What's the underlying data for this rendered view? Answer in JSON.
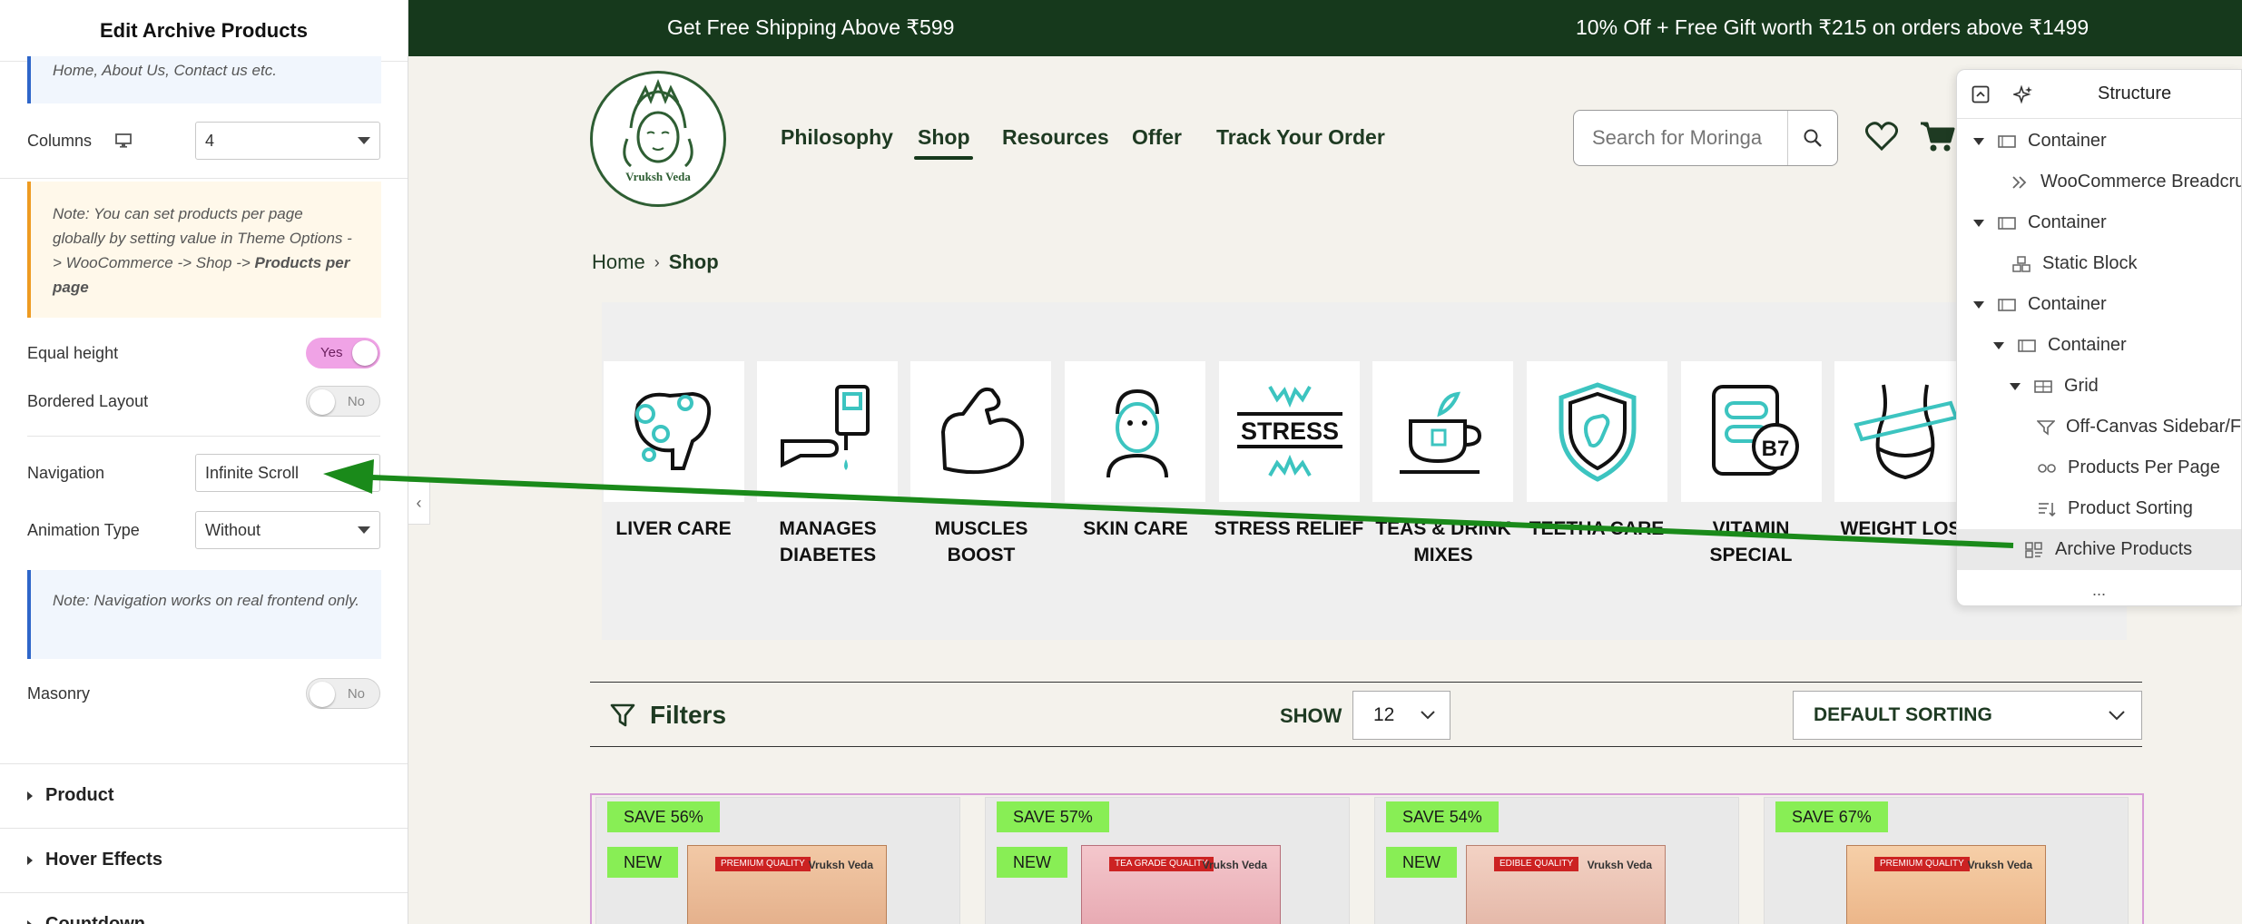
{
  "panel": {
    "title": "Edit Archive Products",
    "info_top": "Home, About Us, Contact us etc.",
    "columns_label": "Columns",
    "columns_value": "4",
    "note_text": "Note: You can set products per page globally by setting value in Theme Options -> WooCommerce -> Shop -> ",
    "note_bold": "Products per page",
    "equal_height_label": "Equal height",
    "equal_height_value": "Yes",
    "bordered_label": "Bordered Layout",
    "bordered_value": "No",
    "navigation_label": "Navigation",
    "navigation_value": "Infinite Scroll",
    "animation_label": "Animation Type",
    "animation_value": "Without",
    "nav_note": "Note: Navigation works on real frontend only.",
    "masonry_label": "Masonry",
    "masonry_value": "No",
    "sections": [
      "Product",
      "Hover Effects",
      "Countdown"
    ]
  },
  "topbar": {
    "left": "Get Free Shipping Above ₹599",
    "right": "10% Off + Free Gift worth ₹215 on orders above ₹1499"
  },
  "header": {
    "logo_text": "Vruksh Veda",
    "nav": [
      "Philosophy",
      "Shop",
      "Resources",
      "Offer",
      "Track Your Order"
    ],
    "search_placeholder": "Search for Moringa"
  },
  "breadcrumb": {
    "home": "Home",
    "current": "Shop"
  },
  "categories": [
    "LIVER CARE",
    "MANAGES DIABETES",
    "MUSCLES BOOST",
    "SKIN CARE",
    "STRESS RELIEF",
    "TEAS & DRINK MIXES",
    "TEETHA CARE",
    "VITAMIN SPECIAL",
    "WEIGHT LOS"
  ],
  "stress_icon_text": "STRESS",
  "vitamin_icon_text": "B7",
  "filters": {
    "label": "Filters",
    "show_label": "SHOW",
    "show_value": "12",
    "sort_value": "DEFAULT SORTING"
  },
  "products": [
    {
      "save": "SAVE 56%",
      "new": "NEW",
      "ribbon": "PREMIUM QUALITY",
      "brand": "Vruksh Veda"
    },
    {
      "save": "SAVE 57%",
      "new": "NEW",
      "ribbon": "TEA GRADE QUALITY",
      "brand": "Vruksh Veda"
    },
    {
      "save": "SAVE 54%",
      "new": "NEW",
      "ribbon": "EDIBLE QUALITY",
      "brand": "Vruksh Veda"
    },
    {
      "save": "SAVE 67%",
      "new": "",
      "ribbon": "PREMIUM QUALITY",
      "brand": "Vruksh Veda"
    }
  ],
  "structure": {
    "title": "Structure",
    "items": [
      "Container",
      "WooCommerce Breadcrumb",
      "Container",
      "Static Block",
      "Container",
      "Container",
      "Grid",
      "Off-Canvas Sidebar/Filters",
      "Products Per Page",
      "Product Sorting",
      "Archive Products"
    ],
    "more": "..."
  },
  "colors": {
    "topbar_bg": "#16391c",
    "accent_green": "#1e3a22",
    "toggle_on": "#f0a3e6",
    "badge": "#88ee55",
    "annotation_arrow": "#1a8a1a",
    "teal_icon": "#3cc4c0"
  }
}
